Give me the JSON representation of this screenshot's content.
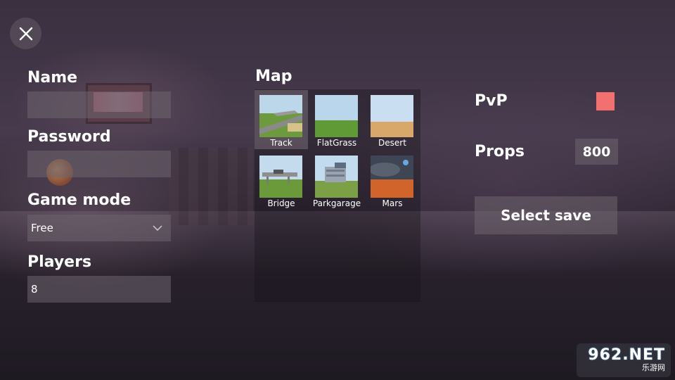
{
  "close_button": {
    "icon": "close-icon"
  },
  "form": {
    "name": {
      "label": "Name",
      "value": ""
    },
    "password": {
      "label": "Password",
      "value": ""
    },
    "game_mode": {
      "label": "Game mode",
      "value": "Free",
      "icon": "chevron-down-icon"
    },
    "players": {
      "label": "Players",
      "value": "8"
    }
  },
  "map": {
    "label": "Map",
    "selected": "Track",
    "items": [
      {
        "name": "Track"
      },
      {
        "name": "FlatGrass"
      },
      {
        "name": "Desert"
      },
      {
        "name": "Bridge"
      },
      {
        "name": "Parkgarage"
      },
      {
        "name": "Mars"
      }
    ]
  },
  "settings": {
    "pvp": {
      "label": "PvP",
      "enabled": true,
      "color": "#f27070"
    },
    "props": {
      "label": "Props",
      "value": "800"
    },
    "select_save": {
      "label": "Select save"
    }
  },
  "watermark": {
    "logo": "962.NET",
    "sub": "乐游网"
  }
}
